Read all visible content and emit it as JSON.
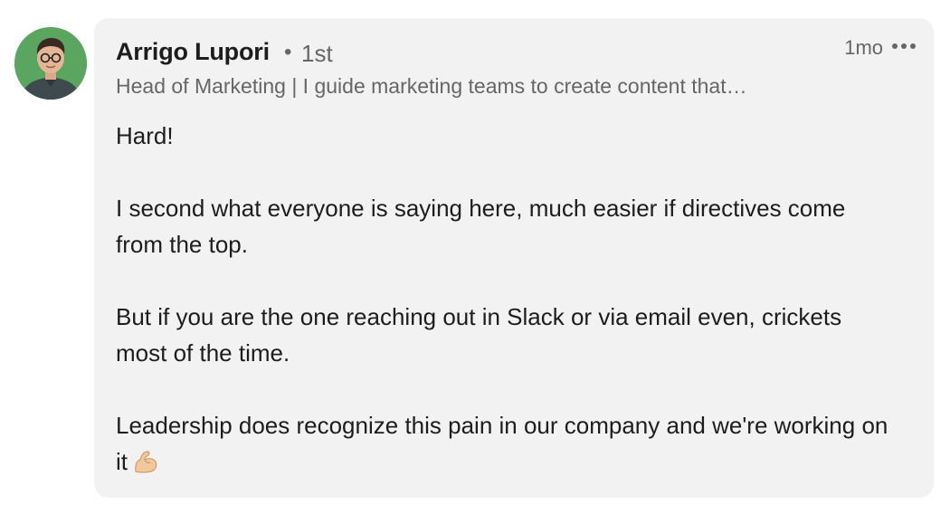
{
  "comment": {
    "author": {
      "name": "Arrigo Lupori",
      "separator": "•",
      "degree": "1st",
      "headline": "Head of Marketing | I guide marketing teams to create content that…"
    },
    "time": "1mo",
    "more_icon": "more-horizontal-icon",
    "paragraphs": [
      "Hard!",
      "I second what everyone is saying here, much easier if directives come from the top.",
      "But if you are the one reaching out in Slack or via email even, crickets most of the time.",
      "Leadership does recognize this pain in our company and we're working on it"
    ],
    "trailing_emoji": "flexed-biceps-icon",
    "colors": {
      "bubble": "#f2f2f2",
      "avatar_bg": "#5aa55f",
      "secondary_text": "#666666"
    }
  }
}
